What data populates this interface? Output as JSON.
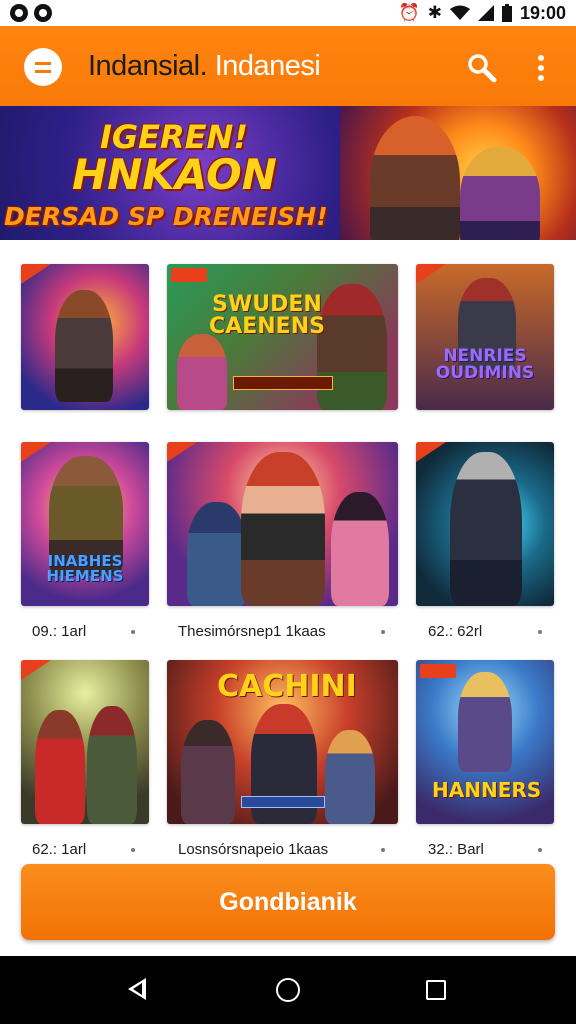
{
  "status_bar": {
    "time": "19:00"
  },
  "app_bar": {
    "title": "Indansial.",
    "title_accent": "Indanesi"
  },
  "banner": {
    "line1": "IGEREN!",
    "line2": "HNKAON",
    "line3": "DERSAD SP DRENEISH!"
  },
  "games": [
    {
      "logo": "",
      "caption": ""
    },
    {
      "logo": "SWUDEN CAENENS",
      "caption": ""
    },
    {
      "logo": "NENRIES OUDIMINS",
      "caption": ""
    },
    {
      "logo": "INABHES HIEMENS",
      "caption": "09.: 1arl"
    },
    {
      "logo": "",
      "caption": "Thesimórsnep1 1kaas"
    },
    {
      "logo": "",
      "caption": "62.: 62rl"
    },
    {
      "logo": "",
      "caption": "62.: 1arl"
    },
    {
      "logo": "CACHINI",
      "caption": "Losnsórsnapeio 1kaas"
    },
    {
      "logo": "HANNERS",
      "caption": "32.: Barl"
    }
  ],
  "cta": {
    "label": "Gondbianik"
  },
  "colors": {
    "primary": "#f97a08",
    "badge": "#e9401c"
  },
  "icons": {
    "menu": "menu-icon",
    "search": "search-icon",
    "more": "more-vert-icon"
  }
}
